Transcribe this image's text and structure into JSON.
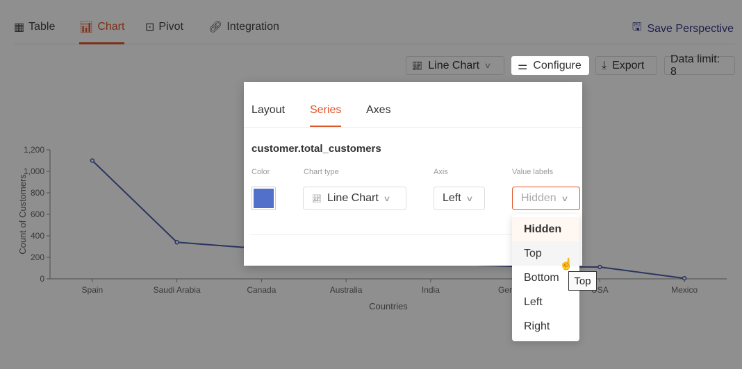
{
  "tabs": [
    {
      "label": "Table",
      "icon": "table-icon"
    },
    {
      "label": "Chart",
      "icon": "bar-chart-icon",
      "active": true
    },
    {
      "label": "Pivot",
      "icon": "pivot-icon"
    },
    {
      "label": "Integration",
      "icon": "link-icon"
    }
  ],
  "save_label": "Save Perspective",
  "toolbar": {
    "chart_type": "Line Chart",
    "configure": "Configure",
    "export": "Export",
    "data_limit": "Data limit: 8"
  },
  "modal": {
    "tabs": [
      "Layout",
      "Series",
      "Axes"
    ],
    "active_tab": "Series",
    "series_name": "customer.total_customers",
    "labels": {
      "color": "Color",
      "chart_type": "Chart type",
      "axis": "Axis",
      "value_labels": "Value labels"
    },
    "color": "#5270c9",
    "chart_type": "Line Chart",
    "axis": "Left",
    "value_labels": "Hidden"
  },
  "dropdown": {
    "options": [
      "Hidden",
      "Top",
      "Bottom",
      "Left",
      "Right"
    ],
    "selected": "Hidden",
    "hovered": "Top"
  },
  "tooltip": "Top",
  "chart_data": {
    "type": "line",
    "categories": [
      "Spain",
      "Saudi Arabia",
      "Canada",
      "Australia",
      "India",
      "Germany",
      "USA",
      "Mexico"
    ],
    "values": [
      1100,
      340,
      280,
      155,
      145,
      115,
      110,
      5
    ],
    "xlabel": "Countries",
    "ylabel": "Count of Customers",
    "ylim": [
      0,
      1200
    ],
    "yticks": [
      0,
      200,
      400,
      600,
      800,
      1000,
      1200
    ],
    "color": "#4a5fa8",
    "grid": false
  }
}
